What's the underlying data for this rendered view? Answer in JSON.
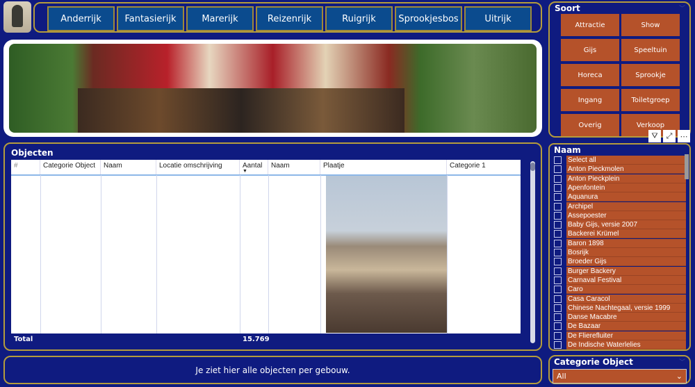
{
  "nav": [
    "Anderrijk",
    "Fantasierijk",
    "Marerijk",
    "Reizenrijk",
    "Ruigrijk",
    "Sprookjesbos",
    "Uitrijk"
  ],
  "objecten": {
    "title": "Objecten",
    "columns": [
      "#",
      "Categorie Object",
      "Naam",
      "Locatie omschrijving",
      "Aantal",
      "Naam",
      "Plaatje",
      "Categorie 1"
    ],
    "total_label": "Total",
    "total_value": "15.769"
  },
  "footer": "Je ziet hier alle objecten per gebouw.",
  "soort": {
    "title": "Soort",
    "buttons": [
      "Attractie",
      "Show",
      "Gijs",
      "Speeltuin",
      "Horeca",
      "Sprookje",
      "Ingang",
      "Toiletgroep",
      "Overig",
      "Verkoop"
    ]
  },
  "naam": {
    "title": "Naam",
    "items": [
      "Select all",
      "Anton Pieckmolen",
      "Anton Pieckplein",
      "Apenfontein",
      "Aquanura",
      "Archipel",
      "Assepoester",
      "Baby Gijs, versie 2007",
      "Backerei Krümel",
      "Baron 1898",
      "Bosrijk",
      "Broeder Gijs",
      "Burger Backery",
      "Carnaval Festival",
      "Caro",
      "Casa Caracol",
      "Chinese Nachtegaal, versie 1999",
      "Danse Macabre",
      "De Bazaar",
      "De Fliereflu​iter",
      "De Indische Waterlelies"
    ]
  },
  "categorie": {
    "title": "Categorie Object",
    "value": "All"
  },
  "colors": {
    "background": "#0f1b80",
    "accent": "#b5522a",
    "border": "#b59c3c",
    "nav": "#0b4b8e"
  }
}
